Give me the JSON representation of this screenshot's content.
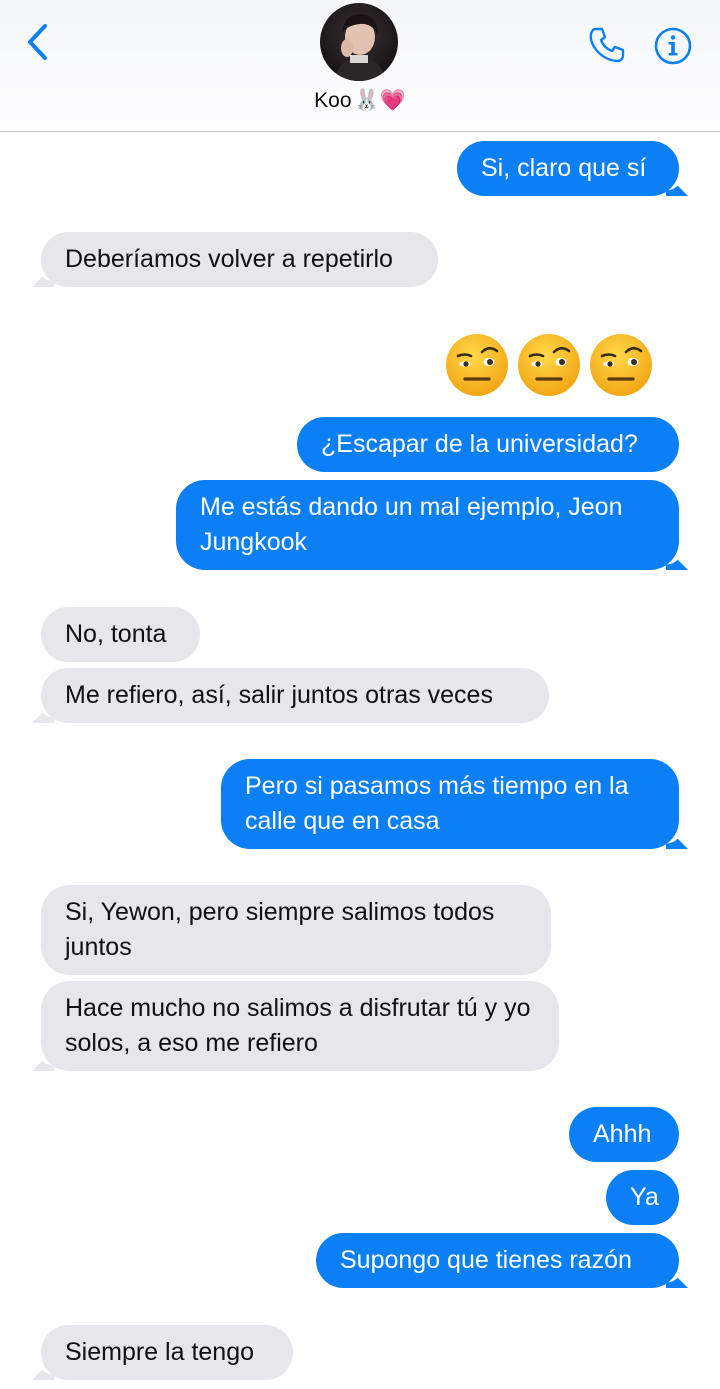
{
  "header": {
    "contact_name": "Koo",
    "contact_emoji": "🐰💗",
    "icons": [
      "chevron-left-icon",
      "phone-icon",
      "info-icon"
    ],
    "accent_color": "#0b7ff5"
  },
  "messages": [
    {
      "direction": "outgoing",
      "text": "Si, claro que sí"
    },
    {
      "direction": "incoming",
      "text": "Deberíamos volver a repetirlo"
    },
    {
      "direction": "outgoing",
      "type": "emoji",
      "emoji": "🤨🤨🤨",
      "icon": "raised-eyebrow-face-icon"
    },
    {
      "direction": "outgoing",
      "text": "¿Escapar de la universidad?"
    },
    {
      "direction": "outgoing",
      "text": "Me estás dando un mal ejemplo, Jeon Jungkook"
    },
    {
      "direction": "incoming",
      "text": "No, tonta"
    },
    {
      "direction": "incoming",
      "text": "Me refiero, así, salir juntos otras veces"
    },
    {
      "direction": "outgoing",
      "text": "Pero si pasamos más tiempo en la calle que en casa"
    },
    {
      "direction": "incoming",
      "text": "Si, Yewon, pero siempre salimos todos juntos"
    },
    {
      "direction": "incoming",
      "text": "Hace mucho no salimos a disfrutar tú y yo solos, a eso me refiero"
    },
    {
      "direction": "outgoing",
      "text": "Ahhh"
    },
    {
      "direction": "outgoing",
      "text": "Ya"
    },
    {
      "direction": "outgoing",
      "text": "Supongo que tienes razón"
    },
    {
      "direction": "incoming",
      "text": "Siempre la tengo"
    }
  ],
  "colors": {
    "outgoing_bubble": "#0b7ff5",
    "incoming_bubble": "#e6e6eb"
  }
}
